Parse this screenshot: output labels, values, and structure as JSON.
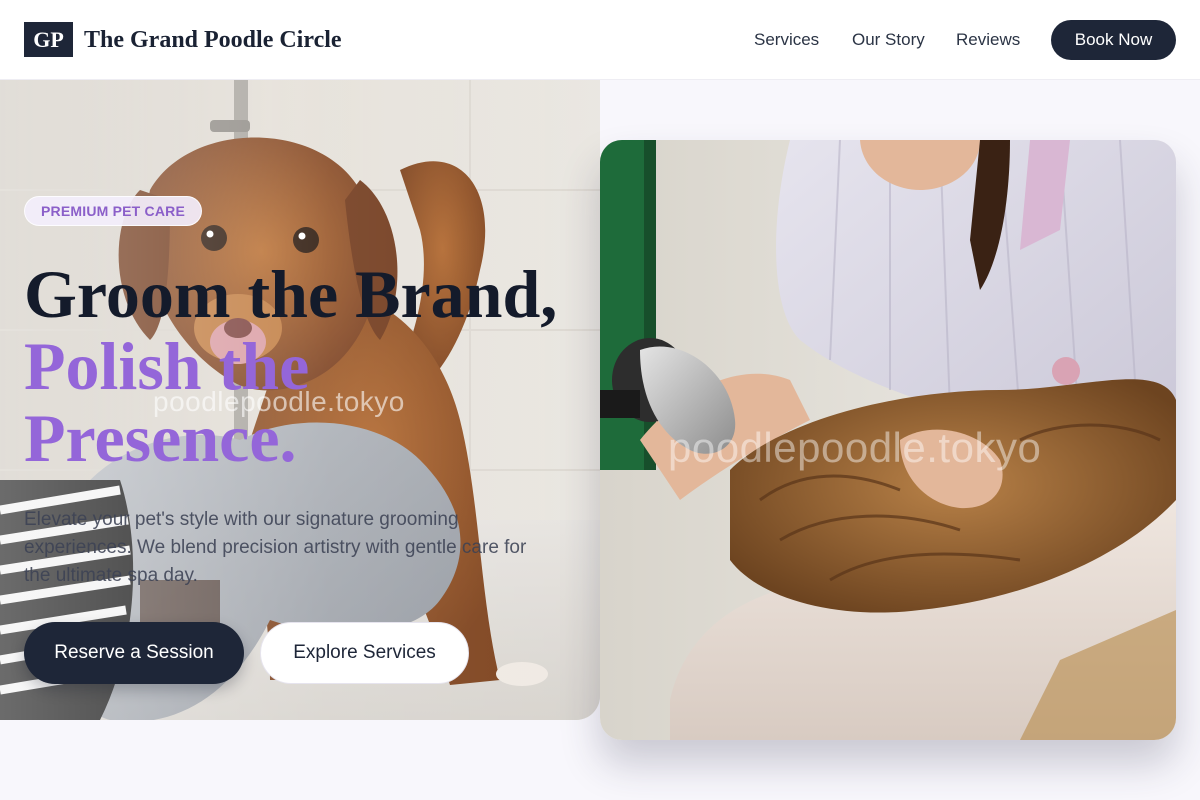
{
  "header": {
    "logo_mark": "GP",
    "brand_name": "The Grand Poodle Circle",
    "nav": {
      "services": "Services",
      "our_story": "Our Story",
      "reviews": "Reviews"
    },
    "cta": "Book Now"
  },
  "hero": {
    "badge": "PREMIUM PET CARE",
    "headline_line1": "Groom the Brand,",
    "headline_line2": "Polish the",
    "headline_line3": "Presence.",
    "subtext": "Elevate your pet's style with our signature grooming experiences. We blend precision artistry with gentle care for the ultimate spa day.",
    "primary_cta": "Reserve a Session",
    "secondary_cta": "Explore Services",
    "photo_watermark": "poodlepoodle.tokyo"
  },
  "side_photo": {
    "watermark": "poodlepoodle.tokyo"
  },
  "colors": {
    "navy": "#1e2638",
    "accent_purple": "#9466d9",
    "badge_text": "#8b5fc9",
    "page_bg": "#f8f7fc"
  }
}
